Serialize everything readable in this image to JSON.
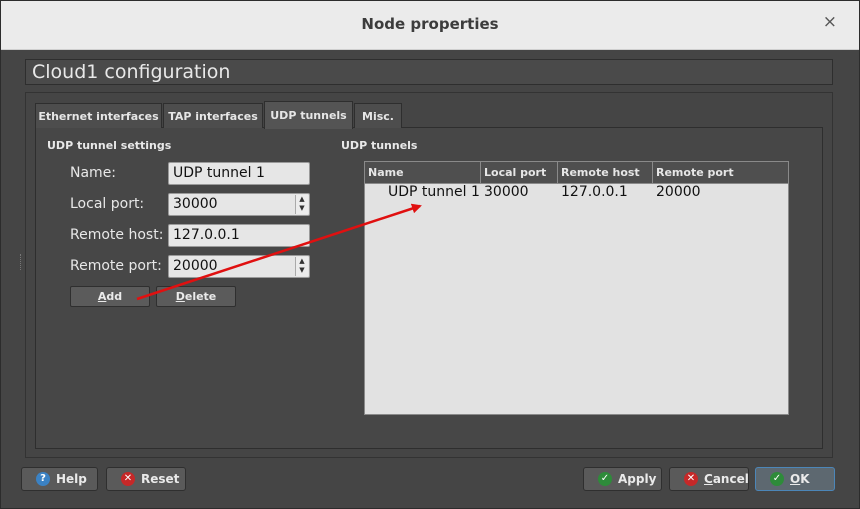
{
  "window": {
    "title": "Node properties",
    "close_glyph": "×"
  },
  "heading": "Cloud1 configuration",
  "tabs": [
    {
      "label": "Ethernet interfaces"
    },
    {
      "label": "TAP interfaces"
    },
    {
      "label": "UDP tunnels",
      "active": true
    },
    {
      "label": "Misc."
    }
  ],
  "settings": {
    "group_title": "UDP tunnel settings",
    "name_label": "Name:",
    "name_value": "UDP tunnel 1",
    "local_port_label": "Local port:",
    "local_port_value": "30000",
    "remote_host_label": "Remote host:",
    "remote_host_value": "127.0.0.1",
    "remote_port_label": "Remote port:",
    "remote_port_value": "20000",
    "add_label_ul": "A",
    "add_label_rest": "dd",
    "delete_label_ul": "D",
    "delete_label_rest": "elete"
  },
  "tunnels": {
    "group_title": "UDP tunnels",
    "columns": [
      "Name",
      "Local port",
      "Remote host",
      "Remote port"
    ],
    "rows": [
      {
        "name": "UDP tunnel 1",
        "local_port": "30000",
        "remote_host": "127.0.0.1",
        "remote_port": "20000"
      }
    ]
  },
  "footer": {
    "help": {
      "label": "Help",
      "icon": "help-icon",
      "glyph": "?"
    },
    "reset": {
      "label": "Reset",
      "icon": "reset-icon",
      "glyph": "✕"
    },
    "apply": {
      "label": "Apply",
      "icon": "check-icon",
      "glyph": "✓"
    },
    "cancel": {
      "label_ul": "C",
      "label_rest": "ancel",
      "icon": "cancel-icon",
      "glyph": "✕"
    },
    "ok": {
      "label_ul": "O",
      "label_rest": "K",
      "icon": "check-icon",
      "glyph": "✓"
    }
  },
  "colors": {
    "accent_blue": "#3b82c4",
    "danger_red": "#c62828",
    "ok_green": "#2e8b3a",
    "arrow_red": "#e01010"
  },
  "annotation": {
    "type": "arrow",
    "from": "add-button",
    "to": "udp-tunnels-table-row"
  }
}
